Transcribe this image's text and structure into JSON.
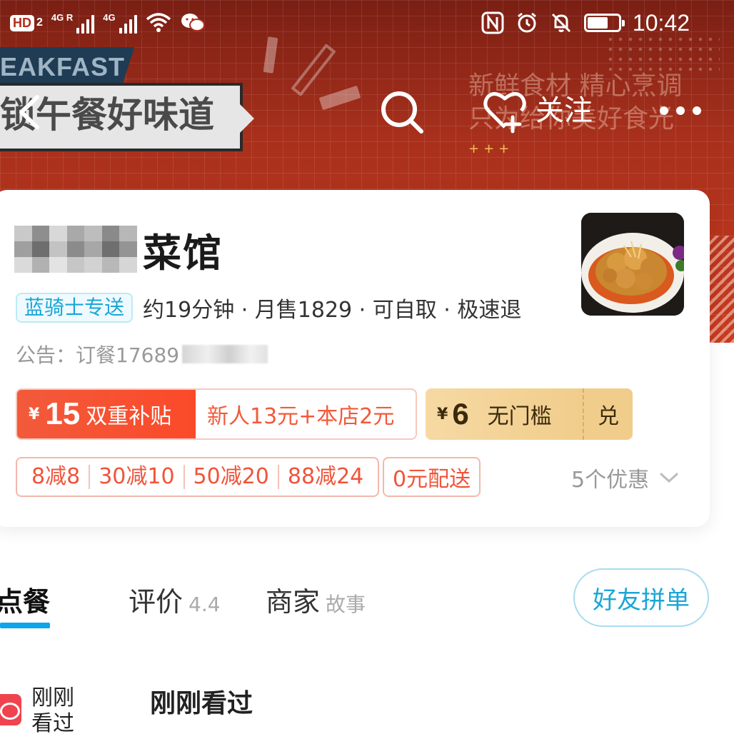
{
  "status_bar": {
    "hd_label": "HD",
    "hd_sim": "2",
    "net1": "4G R",
    "net2": "4G",
    "time": "10:42"
  },
  "banner": {
    "ribbon_text": "EAKFAST",
    "slogan": "锁午餐好味道",
    "tagline_line1": "新鲜食材 精心烹调",
    "tagline_line2": "只为给你美好食光",
    "plus_marks": "+++"
  },
  "nav": {
    "follow_label": "关注",
    "icons": [
      "back-icon",
      "search-icon",
      "heart-plus-icon",
      "more-icon"
    ]
  },
  "shop": {
    "name_suffix": "菜馆",
    "delivery_badge": "蓝骑士专送",
    "info": "约19分钟 · 月售1829 · 可自取 · 极速退",
    "notice": "公告：订餐17689"
  },
  "coupons": {
    "main_currency": "¥",
    "main_amount": "15",
    "main_label": "双重补贴",
    "main_detail": "新人13元+本店2元",
    "gold_currency": "¥",
    "gold_amount": "6",
    "gold_label": "无门槛",
    "gold_action": "兑"
  },
  "discounts": {
    "items": [
      "8减8",
      "30减10",
      "50减20",
      "88减24"
    ],
    "free_shipping": "0元配送",
    "more": "5个优惠"
  },
  "tabs": [
    {
      "label": "点餐",
      "sub": ""
    },
    {
      "label": "评价",
      "sub": "4.4"
    },
    {
      "label": "商家",
      "sub": "故事"
    }
  ],
  "friend_order_label": "好友拼单",
  "menu": {
    "side_label": "刚刚看过",
    "section_title": "刚刚看过"
  },
  "colors": {
    "banner": "#b32d1e",
    "accent_blue": "#1aa6d6",
    "coupon_red": "#f25a3b",
    "coupon_gold": "#f1cd8c",
    "tab_underline": "#0ea5e9"
  }
}
